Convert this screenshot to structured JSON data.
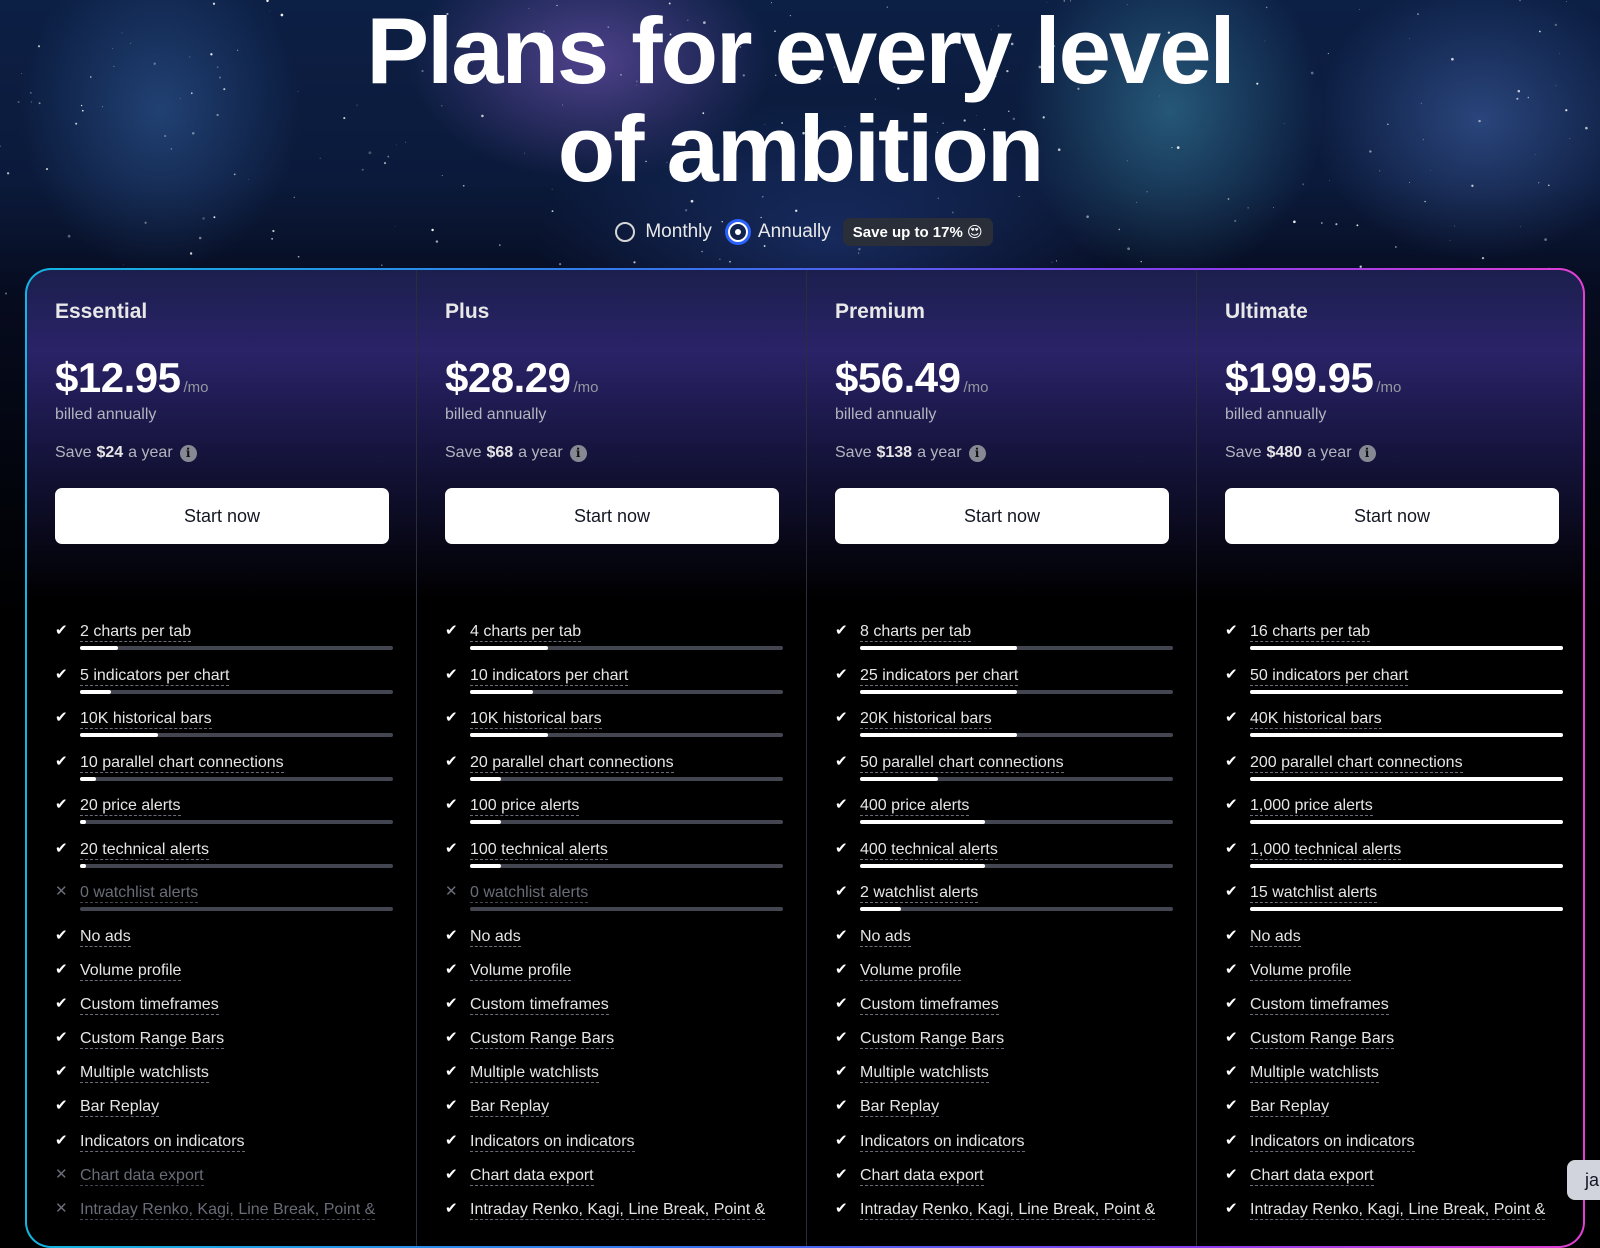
{
  "headline": [
    "Plans for every level",
    "of ambition"
  ],
  "billing": {
    "monthly_label": "Monthly",
    "annually_label": "Annually",
    "selected": "annually",
    "save_badge": "Save up to 17% 😍"
  },
  "common": {
    "per_label": "/mo",
    "billed_label": "billed annually",
    "save_prefix": "Save",
    "save_suffix": "a year",
    "button_label": "Start now"
  },
  "plans": [
    {
      "name": "Essential",
      "price": "$12.95",
      "save_amount": "$24",
      "metered": [
        {
          "text": "2 charts per tab",
          "enabled": true,
          "level": 0.12
        },
        {
          "text": "5 indicators per chart",
          "enabled": true,
          "level": 0.1
        },
        {
          "text": "10K historical bars",
          "enabled": true,
          "level": 0.25
        },
        {
          "text": "10 parallel chart connections",
          "enabled": true,
          "level": 0.05
        },
        {
          "text": "20 price alerts",
          "enabled": true,
          "level": 0.02
        },
        {
          "text": "20 technical alerts",
          "enabled": true,
          "level": 0.02
        },
        {
          "text": "0 watchlist alerts",
          "enabled": false,
          "level": 0
        }
      ],
      "features": [
        {
          "text": "No ads",
          "enabled": true
        },
        {
          "text": "Volume profile",
          "enabled": true
        },
        {
          "text": "Custom timeframes",
          "enabled": true
        },
        {
          "text": "Custom Range Bars",
          "enabled": true
        },
        {
          "text": "Multiple watchlists",
          "enabled": true
        },
        {
          "text": "Bar Replay",
          "enabled": true
        },
        {
          "text": "Indicators on indicators",
          "enabled": true
        },
        {
          "text": "Chart data export",
          "enabled": false
        },
        {
          "text": "Intraday Renko, Kagi, Line Break, Point &",
          "enabled": false
        }
      ]
    },
    {
      "name": "Plus",
      "price": "$28.29",
      "save_amount": "$68",
      "metered": [
        {
          "text": "4 charts per tab",
          "enabled": true,
          "level": 0.25
        },
        {
          "text": "10 indicators per chart",
          "enabled": true,
          "level": 0.2
        },
        {
          "text": "10K historical bars",
          "enabled": true,
          "level": 0.25
        },
        {
          "text": "20 parallel chart connections",
          "enabled": true,
          "level": 0.1
        },
        {
          "text": "100 price alerts",
          "enabled": true,
          "level": 0.1
        },
        {
          "text": "100 technical alerts",
          "enabled": true,
          "level": 0.1
        },
        {
          "text": "0 watchlist alerts",
          "enabled": false,
          "level": 0
        }
      ],
      "features": [
        {
          "text": "No ads",
          "enabled": true
        },
        {
          "text": "Volume profile",
          "enabled": true
        },
        {
          "text": "Custom timeframes",
          "enabled": true
        },
        {
          "text": "Custom Range Bars",
          "enabled": true
        },
        {
          "text": "Multiple watchlists",
          "enabled": true
        },
        {
          "text": "Bar Replay",
          "enabled": true
        },
        {
          "text": "Indicators on indicators",
          "enabled": true
        },
        {
          "text": "Chart data export",
          "enabled": true
        },
        {
          "text": "Intraday Renko, Kagi, Line Break, Point &",
          "enabled": true
        }
      ]
    },
    {
      "name": "Premium",
      "price": "$56.49",
      "save_amount": "$138",
      "metered": [
        {
          "text": "8 charts per tab",
          "enabled": true,
          "level": 0.5
        },
        {
          "text": "25 indicators per chart",
          "enabled": true,
          "level": 0.5
        },
        {
          "text": "20K historical bars",
          "enabled": true,
          "level": 0.5
        },
        {
          "text": "50 parallel chart connections",
          "enabled": true,
          "level": 0.25
        },
        {
          "text": "400 price alerts",
          "enabled": true,
          "level": 0.4
        },
        {
          "text": "400 technical alerts",
          "enabled": true,
          "level": 0.4
        },
        {
          "text": "2 watchlist alerts",
          "enabled": true,
          "level": 0.13
        }
      ],
      "features": [
        {
          "text": "No ads",
          "enabled": true
        },
        {
          "text": "Volume profile",
          "enabled": true
        },
        {
          "text": "Custom timeframes",
          "enabled": true
        },
        {
          "text": "Custom Range Bars",
          "enabled": true
        },
        {
          "text": "Multiple watchlists",
          "enabled": true
        },
        {
          "text": "Bar Replay",
          "enabled": true
        },
        {
          "text": "Indicators on indicators",
          "enabled": true
        },
        {
          "text": "Chart data export",
          "enabled": true
        },
        {
          "text": "Intraday Renko, Kagi, Line Break, Point &",
          "enabled": true
        }
      ]
    },
    {
      "name": "Ultimate",
      "price": "$199.95",
      "save_amount": "$480",
      "metered": [
        {
          "text": "16 charts per tab",
          "enabled": true,
          "level": 1.0
        },
        {
          "text": "50 indicators per chart",
          "enabled": true,
          "level": 1.0
        },
        {
          "text": "40K historical bars",
          "enabled": true,
          "level": 1.0
        },
        {
          "text": "200 parallel chart connections",
          "enabled": true,
          "level": 1.0
        },
        {
          "text": "1,000 price alerts",
          "enabled": true,
          "level": 1.0
        },
        {
          "text": "1,000 technical alerts",
          "enabled": true,
          "level": 1.0
        },
        {
          "text": "15 watchlist alerts",
          "enabled": true,
          "level": 1.0
        }
      ],
      "features": [
        {
          "text": "No ads",
          "enabled": true
        },
        {
          "text": "Volume profile",
          "enabled": true
        },
        {
          "text": "Custom timeframes",
          "enabled": true
        },
        {
          "text": "Custom Range Bars",
          "enabled": true
        },
        {
          "text": "Multiple watchlists",
          "enabled": true
        },
        {
          "text": "Bar Replay",
          "enabled": true
        },
        {
          "text": "Indicators on indicators",
          "enabled": true
        },
        {
          "text": "Chart data export",
          "enabled": true
        },
        {
          "text": "Intraday Renko, Kagi, Line Break, Point &",
          "enabled": true
        }
      ]
    }
  ],
  "side_chip": "ja",
  "icons": {
    "check": "check-icon",
    "cross": "cross-icon",
    "info": "info-icon"
  },
  "colors": {
    "accent_blue": "#2962ff",
    "border_start": "#14b6e0",
    "border_end": "#e43fd3"
  }
}
